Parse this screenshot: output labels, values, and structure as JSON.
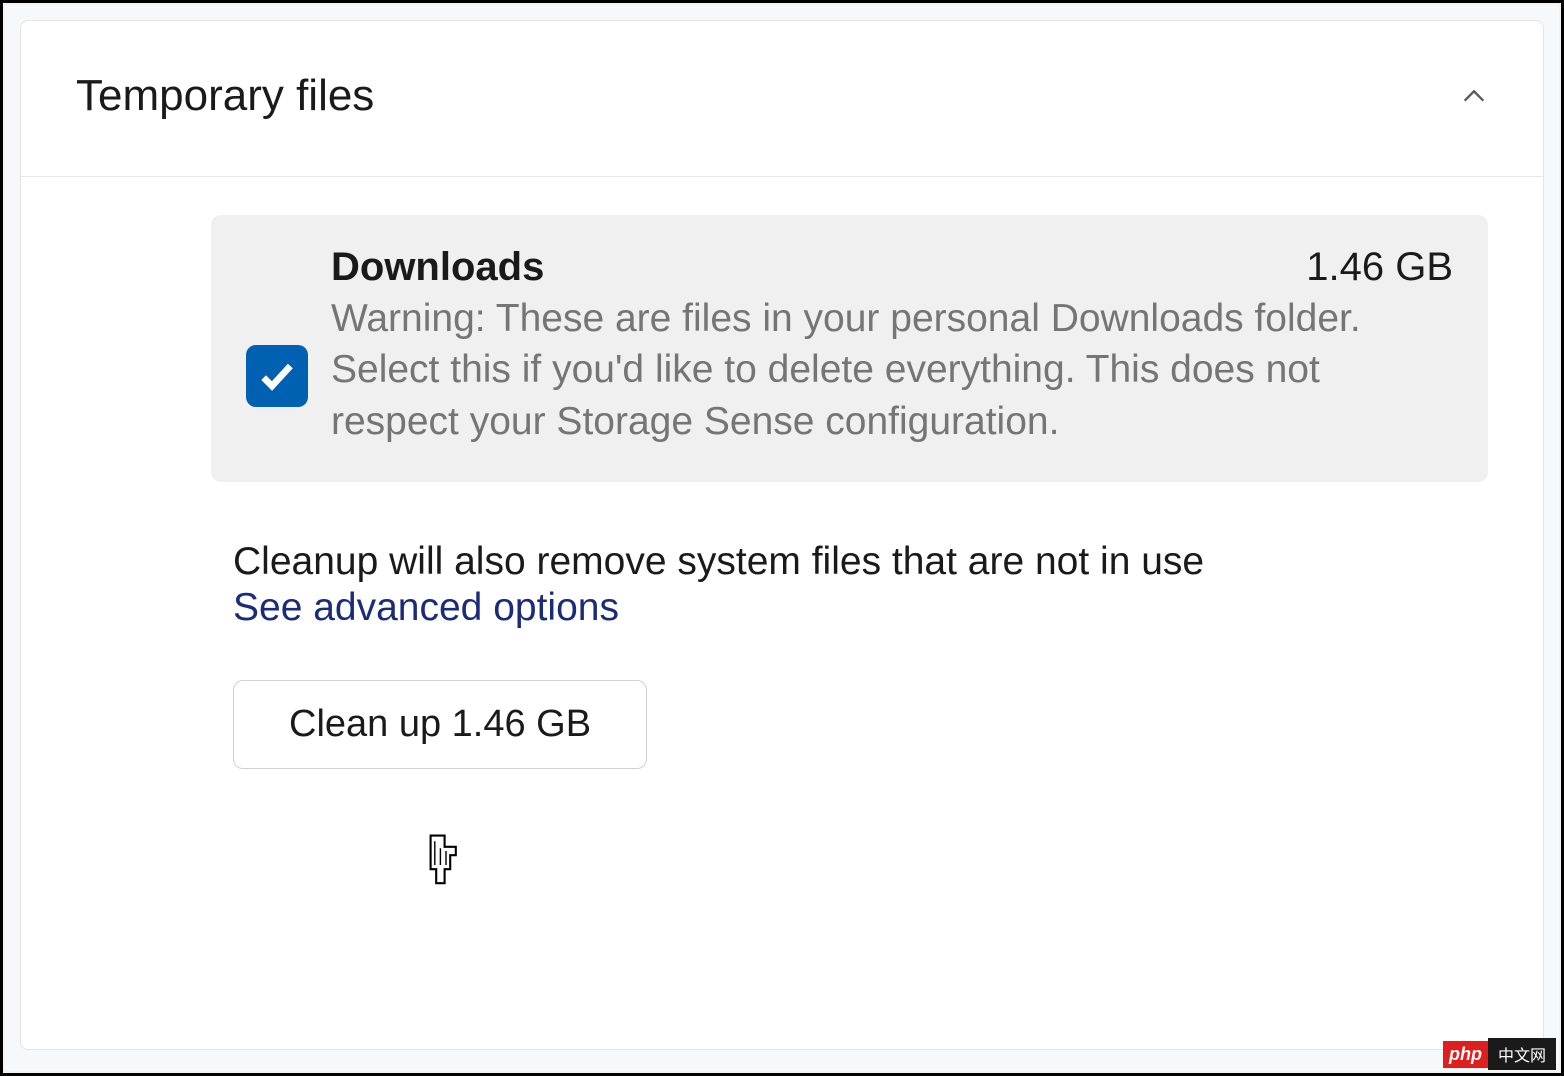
{
  "panel": {
    "title": "Temporary files",
    "expanded": true
  },
  "item": {
    "title": "Downloads",
    "size": "1.46 GB",
    "description": "Warning: These are files in your personal Downloads folder. Select this if you'd like to delete everything. This does not respect your Storage Sense configuration.",
    "checked": true
  },
  "info": {
    "text": "Cleanup will also remove system files that are not in use",
    "link_label": "See advanced options"
  },
  "cleanup_button": {
    "label": "Clean up 1.46 GB"
  },
  "watermark": {
    "left": "php",
    "right": "中文网"
  }
}
